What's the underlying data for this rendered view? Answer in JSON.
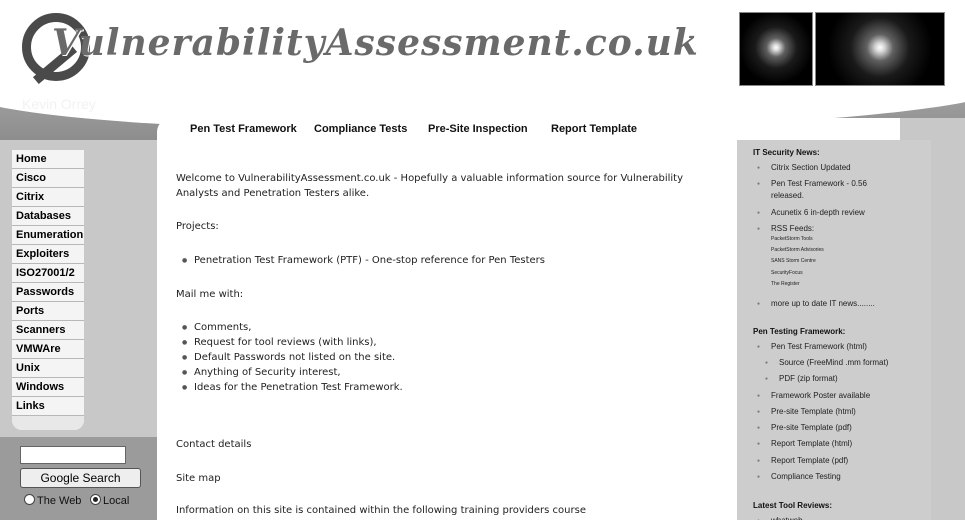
{
  "header": {
    "logo_text": "VulnerabilityAssessment.co.uk",
    "author": "Kevin Orrey"
  },
  "topnav": [
    "Pen Test Framework",
    "Compliance Tests",
    "Pre-Site Inspection",
    "Report Template"
  ],
  "sidebar": {
    "items": [
      "Home",
      "Cisco",
      "Citrix",
      "Databases",
      "Enumeration",
      "Exploiters",
      "ISO27001/2",
      "Passwords",
      "Ports",
      "Scanners",
      "VMWAre",
      "Unix",
      "Windows",
      "Links"
    ]
  },
  "search": {
    "input_value": "",
    "button_label": "Google Search",
    "radio_web": "The Web",
    "radio_local": "Local",
    "selected": "Local"
  },
  "main": {
    "welcome_line1": "Welcome to VulnerabilityAssessment.co.uk -  Hopefully a valuable information source for Vulnerability",
    "welcome_line2": "Analysts and Penetration Testers alike.",
    "projects_heading": "Projects:",
    "projects": [
      "Penetration Test Framework (PTF) -  One-stop reference for Pen Testers"
    ],
    "mail_heading": "Mail  me with:",
    "mail_items": [
      "Comments,",
      "Request for tool reviews (with links),",
      "Default Passwords not listed on the site.",
      "Anything of Security interest,",
      "Ideas for the Penetration Test Framework."
    ],
    "contact": "Contact details",
    "sitemap": "Site map",
    "info": "Information on this site is contained within the following training providers course"
  },
  "right": {
    "news_heading": "IT Security News:",
    "news_items": [
      "Citrix Section Updated",
      "Pen Test Framework - 0.56",
      "released.",
      "Acunetix 6 in-depth review",
      "RSS Feeds:"
    ],
    "rss_feeds": [
      "PacketStorm Tools",
      "PacketStorm Advisories",
      "SANS Storm Centre",
      "SecurityFocus",
      "The Register"
    ],
    "more_news": "more up to date IT news........",
    "ptf_heading": "Pen Testing Framework:",
    "ptf_items": [
      "Pen Test Framework  (html)",
      "Source  (FreeMind .mm format)",
      "PDF       (zip format)",
      "Framework Poster available",
      "Pre-site Template (html)",
      "Pre-site Template (pdf)",
      "Report Template (html)",
      "Report Template (pdf)",
      "Compliance Testing"
    ],
    "reviews_heading": "Latest Tool Reviews:",
    "reviews_partial": "whatweb"
  }
}
